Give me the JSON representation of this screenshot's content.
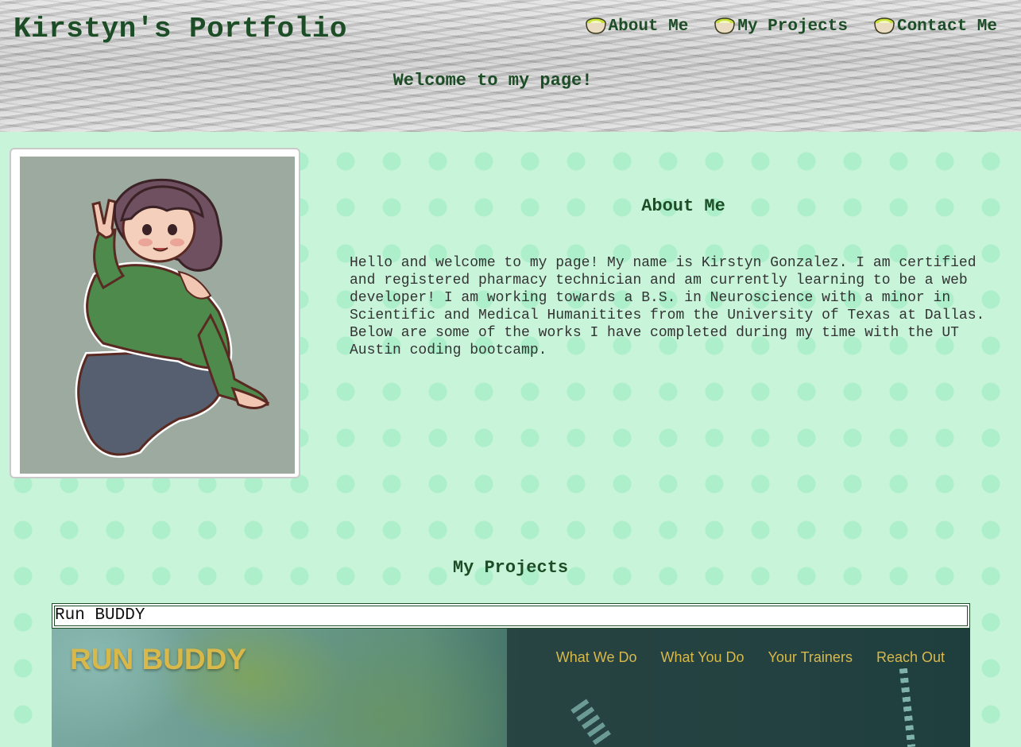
{
  "header": {
    "site_title": "Kirstyn's Portfolio",
    "welcome": "Welcome to my page!",
    "nav": [
      {
        "label": "About Me",
        "icon": "bowl-icon"
      },
      {
        "label": "My Projects",
        "icon": "bowl-icon"
      },
      {
        "label": "Contact Me",
        "icon": "bowl-icon"
      }
    ]
  },
  "about": {
    "heading": "About Me",
    "text": "Hello and welcome to my page! My name is Kirstyn Gonzalez. I am certified and registered pharmacy technician and am currently learning to be a web developer! I am working towards a B.S. in Neuroscience with a minor in Scientific and Medical Humanitites from the University of Texas at Dallas. Below are some of the works I have completed during my time with the UT Austin coding bootcamp."
  },
  "projects": {
    "heading": "My Projects",
    "items": [
      {
        "label": "Run BUDDY",
        "preview": {
          "logo": "RUN BUDDY",
          "nav": [
            "What We Do",
            "What You Do",
            "Your Trainers",
            "Reach Out"
          ]
        }
      }
    ]
  },
  "colors": {
    "heading_green": "#1d4d26",
    "body_text": "#333333",
    "accent_gold": "#d9b84a",
    "page_bg": "#f2fff7"
  }
}
